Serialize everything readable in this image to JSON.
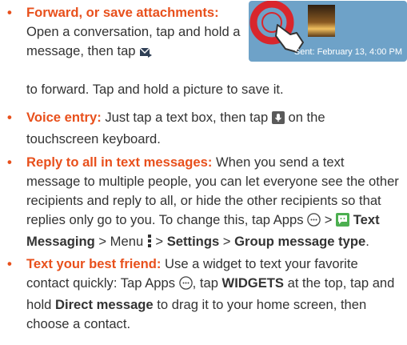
{
  "items": [
    {
      "lead": "Forward, or save attachments:",
      "text1": " Open a conversation, tap and hold a message, then tap ",
      "text2": " to forward. Tap and hold a picture to save it."
    },
    {
      "lead": "Voice entry:",
      "text1": " Just tap a text box, then tap ",
      "text2": " on the touchscreen keyboard."
    },
    {
      "lead": "Reply to all in text messages:",
      "text1": " When you send a text message to multiple people, you can let everyone see the other recipients and reply to all, or hide the other recipients so that replies only go to you. To change this, tap Apps ",
      "text2": " > ",
      "bold1": "Text Messaging",
      "text3": " > Menu ",
      "text4": " > ",
      "bold2": "Settings",
      "text5": " > ",
      "bold3": "Group message type",
      "text6": "."
    },
    {
      "lead": "Text your best friend:",
      "text1": " Use a widget to text your favorite contact quickly: Tap Apps ",
      "text2": ", tap ",
      "bold1": "WIDGETS",
      "text3": " at the top, tap and hold ",
      "bold2": "Direct message",
      "text4": " to drag it to your home screen, then choose a contact."
    }
  ],
  "thumbnail": {
    "sent_label": "Sent: February 13, 4:00 PM"
  },
  "colors": {
    "accent": "#e8501c",
    "thumb_bg": "#6ea2c8",
    "body_text": "#333333"
  },
  "icons": [
    "forward-icon",
    "microphone-icon",
    "apps-icon",
    "text-messaging-app-icon",
    "menu-icon",
    "touch-gesture-icon"
  ]
}
